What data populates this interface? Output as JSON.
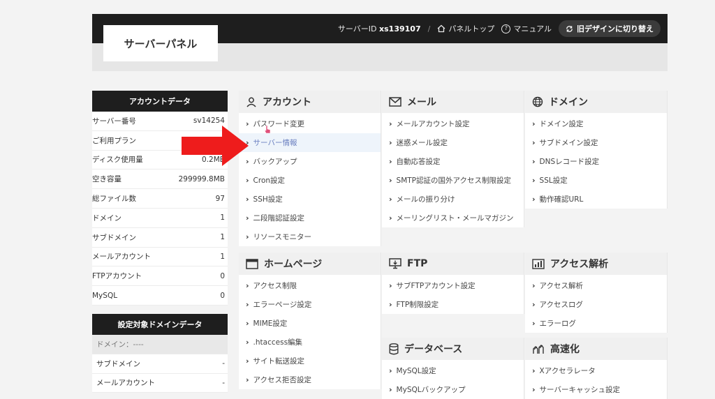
{
  "header": {
    "title": "サーバーパネル",
    "server_id_label": "サーバーID",
    "server_id": "xs139107",
    "separator": "/",
    "panel_top": "パネルトップ",
    "manual": "マニュアル",
    "old_design": "旧デザインに切り替え"
  },
  "sidebar": {
    "account_header": "アカウントデータ",
    "account_rows": [
      {
        "label": "サーバー番号",
        "value": "sv14254"
      },
      {
        "label": "ご利用プラン",
        "value": ""
      },
      {
        "label": "ディスク使用量",
        "value": "0.2MB"
      },
      {
        "label": "空き容量",
        "value": "299999.8MB"
      },
      {
        "label": "総ファイル数",
        "value": "97"
      },
      {
        "label": "ドメイン",
        "value": "1"
      },
      {
        "label": "サブドメイン",
        "value": "1"
      },
      {
        "label": "メールアカウント",
        "value": "1"
      },
      {
        "label": "FTPアカウント",
        "value": "0"
      },
      {
        "label": "MySQL",
        "value": "0"
      }
    ],
    "domain_header": "設定対象ドメインデータ",
    "domain_rows": [
      {
        "label": "ドメイン：----",
        "value": ""
      },
      {
        "label": "サブドメイン",
        "value": "-"
      },
      {
        "label": "メールアカウント",
        "value": "-"
      }
    ]
  },
  "sections": {
    "account": {
      "title": "アカウント",
      "items": [
        "パスワード変更",
        "サーバー情報",
        "バックアップ",
        "Cron設定",
        "SSH設定",
        "二段階認証設定",
        "リソースモニター"
      ]
    },
    "mail": {
      "title": "メール",
      "items": [
        "メールアカウント設定",
        "迷惑メール設定",
        "自動応答設定",
        "SMTP認証の国外アクセス制限設定",
        "メールの振り分け",
        "メーリングリスト・メールマガジン"
      ]
    },
    "domain": {
      "title": "ドメイン",
      "items": [
        "ドメイン設定",
        "サブドメイン設定",
        "DNSレコード設定",
        "SSL設定",
        "動作確認URL"
      ]
    },
    "homepage": {
      "title": "ホームページ",
      "items": [
        "アクセス制限",
        "エラーページ設定",
        "MIME設定",
        ".htaccess編集",
        "サイト転送設定",
        "アクセス拒否設定"
      ]
    },
    "ftp": {
      "title": "FTP",
      "items": [
        "サブFTPアカウント設定",
        "FTP制限設定"
      ]
    },
    "analytics": {
      "title": "アクセス解析",
      "items": [
        "アクセス解析",
        "アクセスログ",
        "エラーログ"
      ]
    },
    "database": {
      "title": "データベース",
      "items": [
        "MySQL設定",
        "MySQLバックアップ"
      ]
    },
    "speed": {
      "title": "高速化",
      "items": [
        "Xアクセラレータ",
        "サーバーキャッシュ設定"
      ]
    }
  },
  "colors": {
    "topbar": "#1e1e1e",
    "highlight_text": "#6a7fc0",
    "arrow": "#ee1c1c"
  }
}
